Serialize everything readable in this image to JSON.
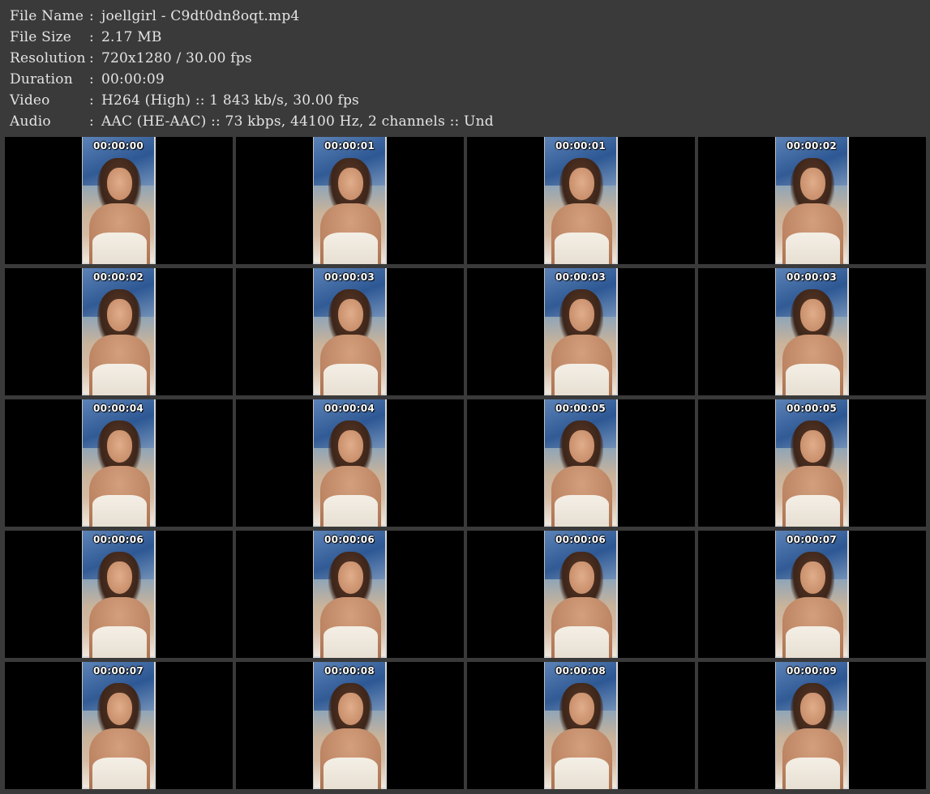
{
  "info": [
    {
      "label": "File Name",
      "sep": ":",
      "value": "joellgirl - C9dt0dn8oqt.mp4"
    },
    {
      "label": "File Size",
      "sep": ":",
      "value": "2.17 MB"
    },
    {
      "label": "Resolution",
      "sep": ":",
      "value": "720x1280 / 30.00 fps"
    },
    {
      "label": "Duration",
      "sep": ":",
      "value": "00:00:09"
    },
    {
      "label": "Video",
      "sep": ":",
      "value": "H264 (High) :: 1 843 kb/s, 30.00 fps"
    },
    {
      "label": "Audio",
      "sep": ":",
      "value": "AAC (HE-AAC) :: 73 kbps, 44100 Hz, 2 channels :: Und"
    }
  ],
  "thumbnails": [
    "00:00:00",
    "00:00:01",
    "00:00:01",
    "00:00:02",
    "00:00:02",
    "00:00:03",
    "00:00:03",
    "00:00:03",
    "00:00:04",
    "00:00:04",
    "00:00:05",
    "00:00:05",
    "00:00:06",
    "00:00:06",
    "00:00:06",
    "00:00:07",
    "00:00:07",
    "00:00:08",
    "00:00:08",
    "00:00:09"
  ],
  "colors": {
    "background": "#3a3a3a",
    "text": "#e4e4e4",
    "cell": "#000000",
    "frame_border": "#d8d8d8"
  }
}
